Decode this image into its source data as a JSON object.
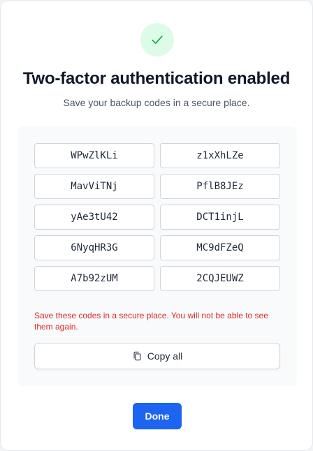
{
  "dialog": {
    "title": "Two-factor authentication enabled",
    "subtitle": "Save your backup codes in a secure place."
  },
  "codes": [
    "WPwZlKLi",
    "z1xXhLZe",
    "MavViTNj",
    "PflB8JEz",
    "yAe3tU42",
    "DCT1injL",
    "6NyqHR3G",
    "MC9dFZeQ",
    "A7b92zUM",
    "2CQJEUWZ"
  ],
  "warning": "Save these codes in a secure place. You will not be able to see them again.",
  "copy_button": {
    "label": "Copy all",
    "icon": "copy-icon"
  },
  "done_button": {
    "label": "Done"
  },
  "icons": {
    "success": "check-icon"
  },
  "colors": {
    "success_bg": "#dcfce7",
    "success_fg": "#16a34a",
    "warning": "#dc2626",
    "primary": "#1d64f0"
  }
}
